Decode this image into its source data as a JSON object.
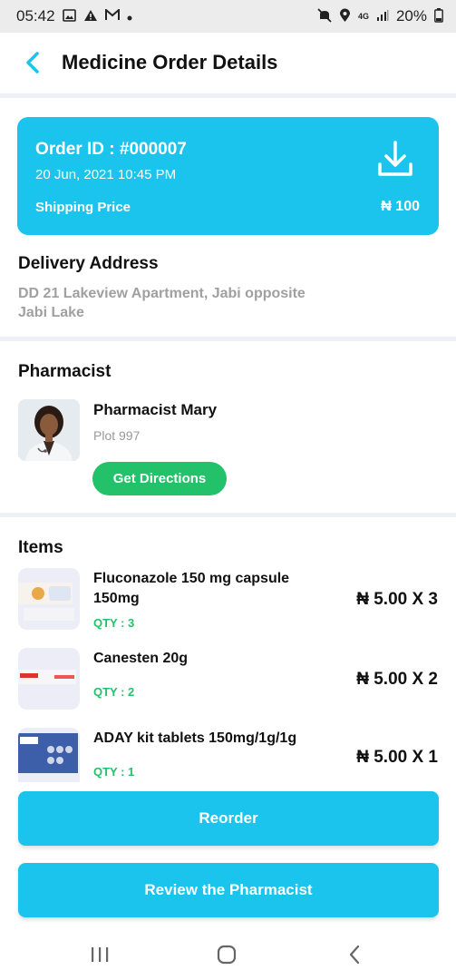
{
  "status_bar": {
    "time": "05:42",
    "network": "4G",
    "battery": "20%"
  },
  "header": {
    "title": "Medicine Order Details",
    "back_icon": "chevron-left-icon"
  },
  "order": {
    "id_label": "Order ID : #000007",
    "date": "20 Jun, 2021 10:45 PM",
    "shipping_label": "Shipping Price",
    "shipping_price": "₦ 100",
    "download_icon": "download-icon",
    "card_color": "#1ac4ec"
  },
  "delivery": {
    "title": "Delivery Address",
    "address": "DD 21 Lakeview Apartment, Jabi opposite Jabi Lake"
  },
  "pharmacist": {
    "title": "Pharmacist",
    "name": "Pharmacist Mary",
    "plot": "Plot 997",
    "directions_label": "Get Directions",
    "directions_color": "#23c26a"
  },
  "items": {
    "title": "Items",
    "list": [
      {
        "name": "Fluconazole 150 mg capsule 150mg",
        "qty": "QTY : 3",
        "price": "₦ 5.00 X 3"
      },
      {
        "name": "Canesten 20g",
        "qty": "QTY : 2",
        "price": "₦ 5.00 X 2"
      },
      {
        "name": "ADAY kit tablets 150mg/1g/1g",
        "qty": "QTY : 1",
        "price": "₦ 5.00 X 1"
      }
    ]
  },
  "actions": {
    "reorder_label": "Reorder",
    "review_label": "Review the Pharmacist"
  },
  "nav": {
    "recents_icon": "recents-icon",
    "home_icon": "home-icon",
    "back_icon": "back-icon"
  }
}
